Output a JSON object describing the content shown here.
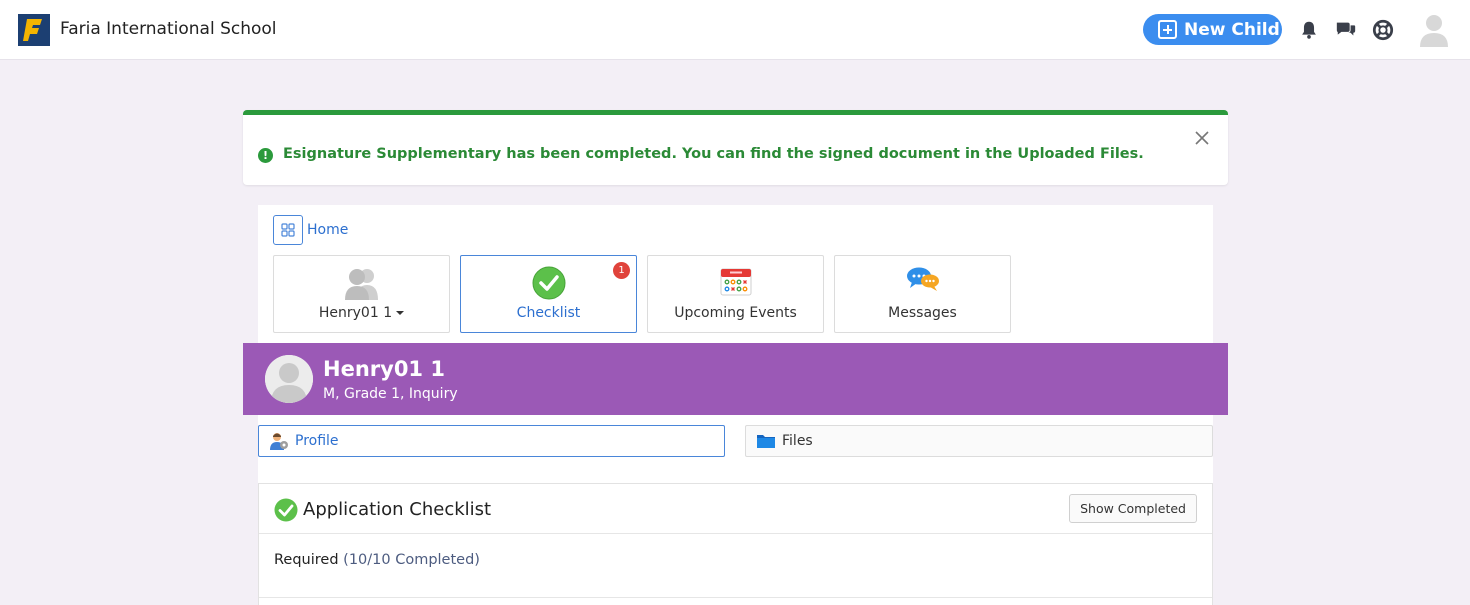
{
  "header": {
    "school_name": "Faria International School",
    "new_child_label": "New Child"
  },
  "alert": {
    "message": "Esignature Supplementary has been completed. You can find the signed document in the Uploaded Files.",
    "icon_glyph": "!",
    "color": "#2b9a3c"
  },
  "nav": {
    "home_label": "Home",
    "tiles": [
      {
        "label": "Henry01 1",
        "icon": "children-icon"
      },
      {
        "label": "Checklist",
        "icon": "check-circle-icon",
        "badge": "1"
      },
      {
        "label": "Upcoming Events",
        "icon": "calendar-icon"
      },
      {
        "label": "Messages",
        "icon": "chat-bubbles-icon"
      }
    ]
  },
  "profile": {
    "name": "Henry01 1",
    "details": "M, Grade 1, Inquiry",
    "header_color": "#9b59b6"
  },
  "subnav": {
    "profile_label": "Profile",
    "files_label": "Files"
  },
  "checklist": {
    "title": "Application Checklist",
    "show_completed_label": "Show Completed",
    "required_label": "Required",
    "required_count": "(10/10 Completed)"
  }
}
